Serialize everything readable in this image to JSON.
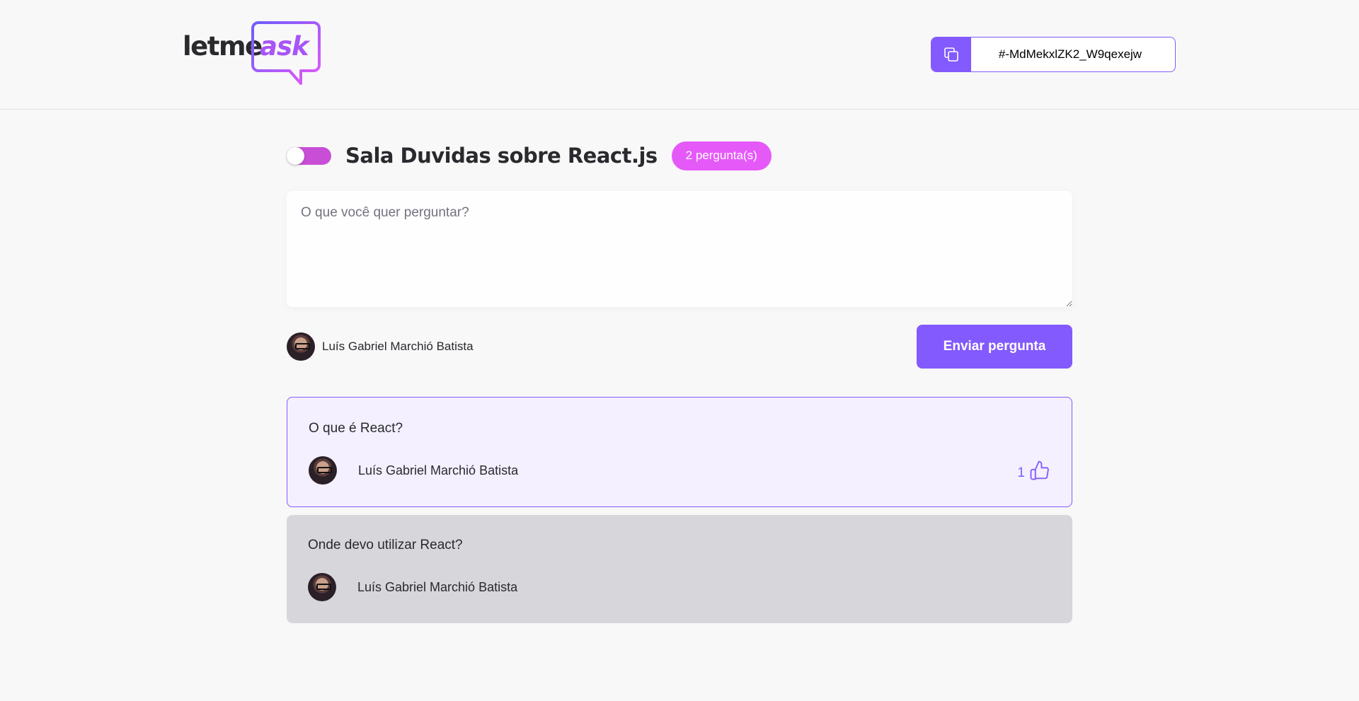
{
  "header": {
    "logo": {
      "part1": "letme",
      "part2": "ask"
    },
    "room_code": {
      "value": "#-MdMekxlZK2_W9qexejw",
      "icon": "copy-icon"
    }
  },
  "room": {
    "title": "Sala Duvidas sobre React.js",
    "question_count": "2 pergunta(s)",
    "toggle_state": "on"
  },
  "form": {
    "placeholder": "O que você quer perguntar?",
    "value": "",
    "user_name": "Luís Gabriel Marchió Batista",
    "submit_label": "Enviar pergunta"
  },
  "questions": [
    {
      "content": "O que é React?",
      "author": "Luís Gabriel Marchió Batista",
      "like_count": "1",
      "highlighted": true
    },
    {
      "content": "Onde devo utilizar React?",
      "author": "Luís Gabriel Marchió Batista",
      "answered": true
    }
  ],
  "colors": {
    "primary": "#835afd",
    "pink": "#e559f9",
    "toggle": "#c94ed6",
    "highlight_bg": "#f4f0ff",
    "answered_bg": "#d7d6db"
  }
}
